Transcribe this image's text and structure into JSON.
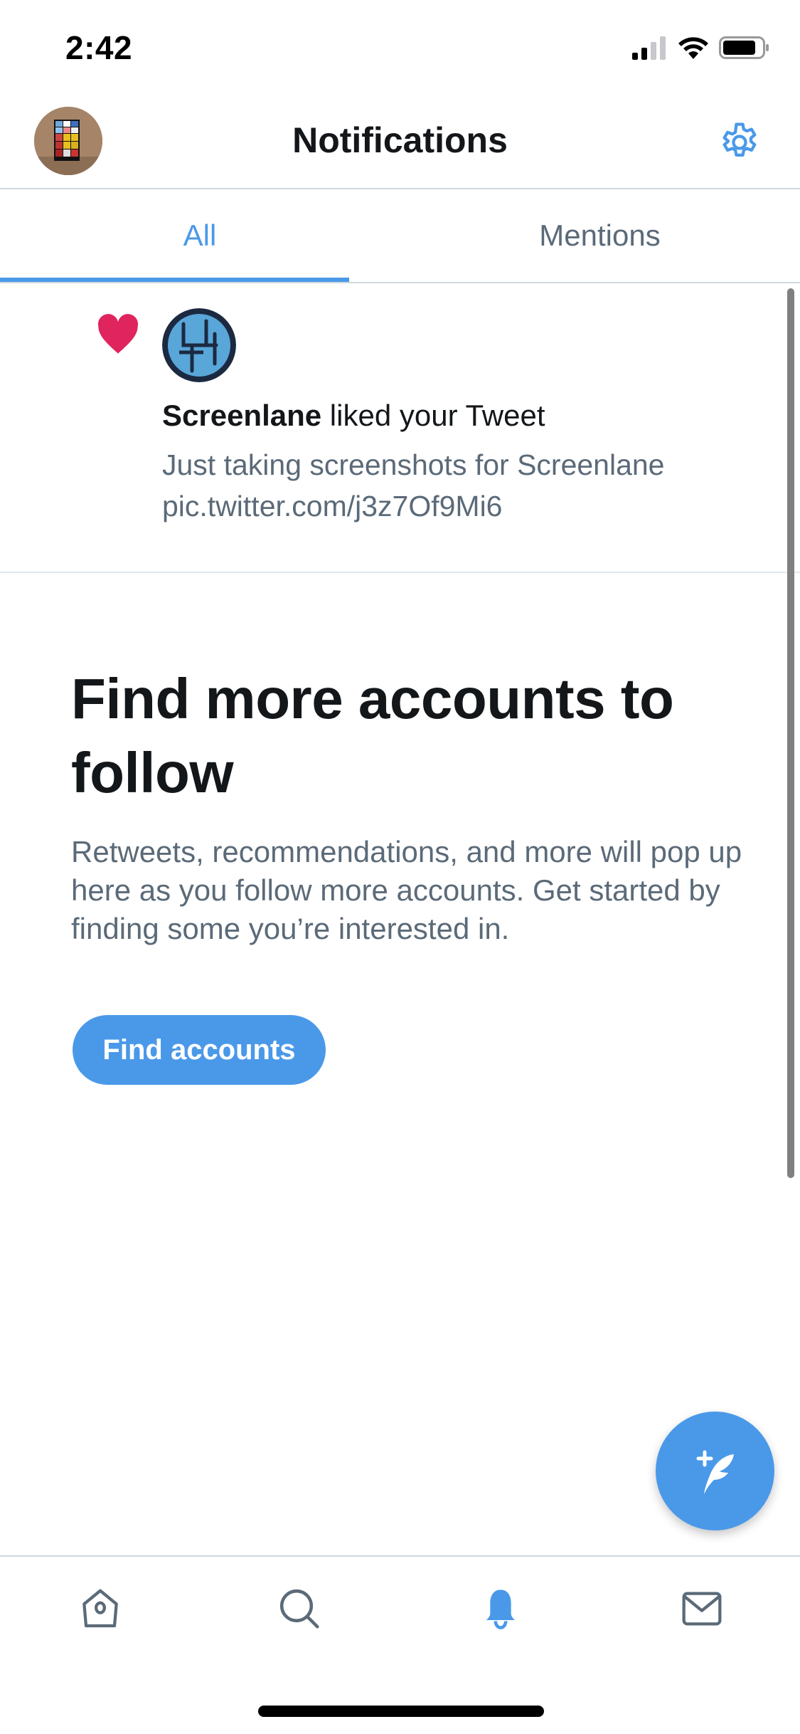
{
  "status_bar": {
    "time": "2:42",
    "icons": [
      "cellular-signal-icon",
      "wifi-icon",
      "battery-icon"
    ]
  },
  "header": {
    "title": "Notifications",
    "left_icon": "profile-avatar",
    "right_icon": "gear-icon"
  },
  "tabs": [
    {
      "label": "All",
      "active": true
    },
    {
      "label": "Mentions",
      "active": false
    }
  ],
  "notifications": [
    {
      "type": "like",
      "icon": "heart-icon",
      "actor": "Screenlane",
      "action": " liked your Tweet",
      "tweet_text_line1": "Just taking screenshots for Screenlane",
      "tweet_text_line2": "pic.twitter.com/j3z7Of9Mi6"
    }
  ],
  "empty_state": {
    "title": "Find more accounts to follow",
    "body": "Retweets, recommendations, and more will pop up here as you follow more accounts. Get started by finding some you’re interested in.",
    "button_label": "Find accounts"
  },
  "fab": {
    "icon": "compose-tweet-icon"
  },
  "bottom_nav": [
    {
      "name": "home",
      "icon": "home-icon",
      "active": false
    },
    {
      "name": "search",
      "icon": "search-icon",
      "active": false
    },
    {
      "name": "notifications",
      "icon": "bell-icon",
      "active": true
    },
    {
      "name": "messages",
      "icon": "mail-icon",
      "active": false
    }
  ],
  "colors": {
    "accent": "#4a99e9",
    "like": "#e0245e",
    "text_primary": "#14171a",
    "text_secondary": "#5b6a78",
    "divider": "#cfd9de"
  }
}
